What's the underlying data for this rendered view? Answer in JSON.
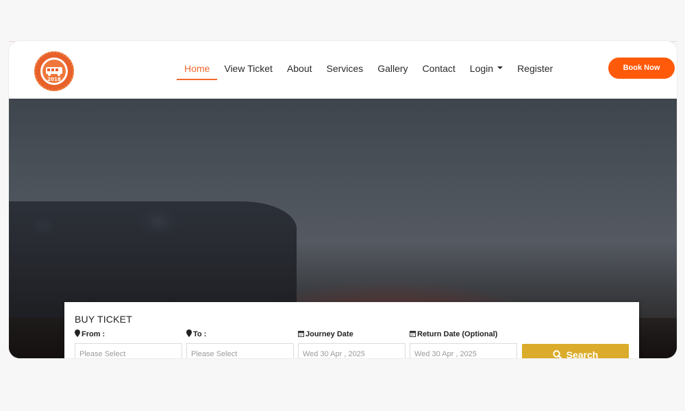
{
  "logo": {
    "top_text": "Delhi To Nepal Bus",
    "year": "2018",
    "bottom_text": "Comfort & Safety"
  },
  "nav": {
    "items": [
      {
        "label": "Home",
        "active": true
      },
      {
        "label": "View Ticket"
      },
      {
        "label": "About"
      },
      {
        "label": "Services"
      },
      {
        "label": "Gallery"
      },
      {
        "label": "Contact"
      },
      {
        "label": "Login",
        "dropdown": true
      },
      {
        "label": "Register"
      }
    ],
    "cta": "Book Now"
  },
  "booking": {
    "title": "BUY TICKET",
    "from": {
      "label": "From :",
      "placeholder": "Please Select",
      "icon": "map-marker-icon"
    },
    "to": {
      "label": "To :",
      "placeholder": "Please Select",
      "icon": "map-marker-icon"
    },
    "journey_date": {
      "label": "Journey Date",
      "value": "Wed 30 Apr , 2025",
      "icon": "calendar-icon"
    },
    "return_date": {
      "label": "Return Date (Optional)",
      "value": "Wed 30 Apr , 2025",
      "icon": "calendar-icon"
    },
    "search_label": "Search"
  },
  "colors": {
    "accent": "#f26a2e",
    "cta": "#ff5a0a",
    "search": "#dbac2b"
  }
}
